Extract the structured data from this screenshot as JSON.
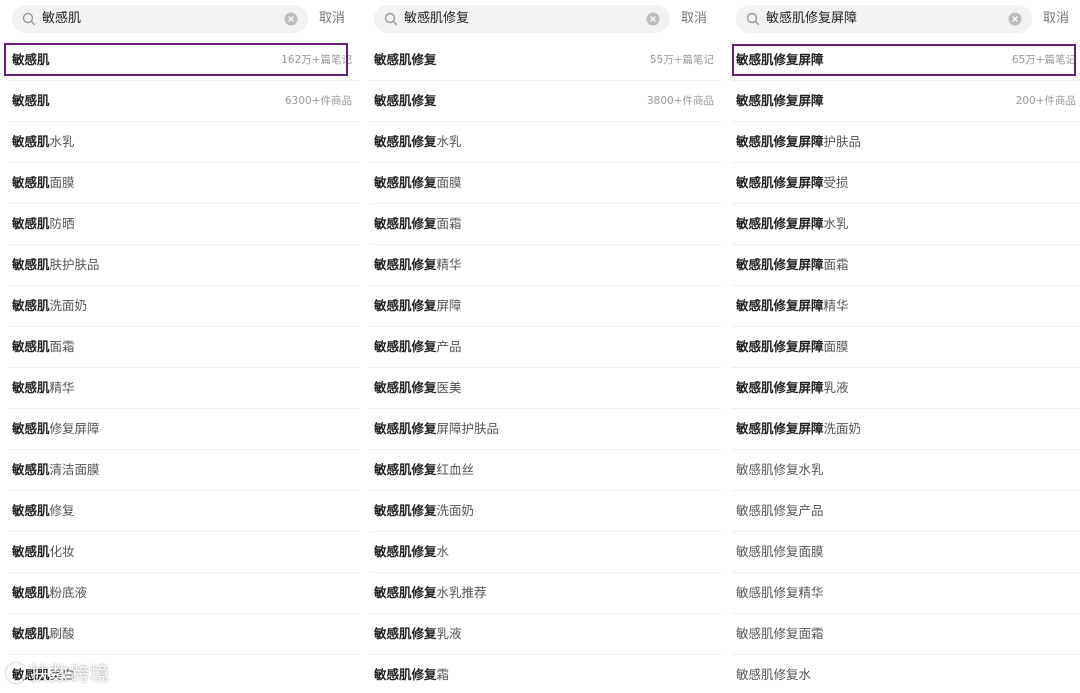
{
  "panels": [
    {
      "search": {
        "query": "敏感肌",
        "cancel": "取消"
      },
      "rows": [
        {
          "pre": "敏感肌",
          "suf": "",
          "meta": "162万+篇笔记"
        },
        {
          "pre": "敏感肌",
          "suf": "",
          "meta": "6300+件商品"
        },
        {
          "pre": "敏感肌",
          "suf": "水乳",
          "meta": ""
        },
        {
          "pre": "敏感肌",
          "suf": "面膜",
          "meta": ""
        },
        {
          "pre": "敏感肌",
          "suf": "防晒",
          "meta": ""
        },
        {
          "pre": "敏感肌",
          "suf": "肤护肤品",
          "meta": ""
        },
        {
          "pre": "敏感肌",
          "suf": "洗面奶",
          "meta": ""
        },
        {
          "pre": "敏感肌",
          "suf": "面霜",
          "meta": ""
        },
        {
          "pre": "敏感肌",
          "suf": "精华",
          "meta": ""
        },
        {
          "pre": "敏感肌",
          "suf": "修复屏障",
          "meta": ""
        },
        {
          "pre": "敏感肌",
          "suf": "清洁面膜",
          "meta": ""
        },
        {
          "pre": "敏感肌",
          "suf": "修复",
          "meta": ""
        },
        {
          "pre": "敏感肌",
          "suf": "化妆",
          "meta": ""
        },
        {
          "pre": "敏感肌",
          "suf": "粉底液",
          "meta": ""
        },
        {
          "pre": "敏感肌",
          "suf": "刷酸",
          "meta": ""
        },
        {
          "pre": "敏感肌",
          "suf": "美白",
          "meta": ""
        }
      ]
    },
    {
      "search": {
        "query": "敏感肌修复",
        "cancel": "取消"
      },
      "rows": [
        {
          "pre": "敏感肌修复",
          "suf": "",
          "meta": "55万+篇笔记"
        },
        {
          "pre": "敏感肌修复",
          "suf": "",
          "meta": "3800+件商品"
        },
        {
          "pre": "敏感肌修复",
          "suf": "水乳",
          "meta": ""
        },
        {
          "pre": "敏感肌修复",
          "suf": "面膜",
          "meta": ""
        },
        {
          "pre": "敏感肌修复",
          "suf": "面霜",
          "meta": ""
        },
        {
          "pre": "敏感肌修复",
          "suf": "精华",
          "meta": ""
        },
        {
          "pre": "敏感肌修复",
          "suf": "屏障",
          "meta": ""
        },
        {
          "pre": "敏感肌修复",
          "suf": "产品",
          "meta": ""
        },
        {
          "pre": "敏感肌修复",
          "suf": "医美",
          "meta": ""
        },
        {
          "pre": "敏感肌修复",
          "suf": "屏障护肤品",
          "meta": ""
        },
        {
          "pre": "敏感肌修复",
          "suf": "红血丝",
          "meta": ""
        },
        {
          "pre": "敏感肌修复",
          "suf": "洗面奶",
          "meta": ""
        },
        {
          "pre": "敏感肌修复",
          "suf": "水",
          "meta": ""
        },
        {
          "pre": "敏感肌修复",
          "suf": "水乳推荐",
          "meta": ""
        },
        {
          "pre": "敏感肌修复",
          "suf": "乳液",
          "meta": ""
        },
        {
          "pre": "敏感肌修复",
          "suf": "霜",
          "meta": ""
        }
      ]
    },
    {
      "search": {
        "query": "敏感肌修复屏障",
        "cancel": "取消"
      },
      "rows": [
        {
          "pre": "敏感肌修复屏障",
          "suf": "",
          "meta": "65万+篇笔记"
        },
        {
          "pre": "敏感肌修复屏障",
          "suf": "",
          "meta": "200+件商品"
        },
        {
          "pre": "敏感肌修复屏障",
          "suf": "护肤品",
          "meta": ""
        },
        {
          "pre": "敏感肌修复屏障",
          "suf": "受损",
          "meta": ""
        },
        {
          "pre": "敏感肌修复屏障",
          "suf": "水乳",
          "meta": ""
        },
        {
          "pre": "敏感肌修复屏障",
          "suf": "面霜",
          "meta": ""
        },
        {
          "pre": "敏感肌修复屏障",
          "suf": "精华",
          "meta": ""
        },
        {
          "pre": "敏感肌修复屏障",
          "suf": "面膜",
          "meta": ""
        },
        {
          "pre": "敏感肌修复屏障",
          "suf": "乳液",
          "meta": ""
        },
        {
          "pre": "敏感肌修复屏障",
          "suf": "洗面奶",
          "meta": ""
        },
        {
          "pre": "",
          "suf": "敏感肌修复水乳",
          "meta": ""
        },
        {
          "pre": "",
          "suf": "敏感肌修复产品",
          "meta": ""
        },
        {
          "pre": "",
          "suf": "敏感肌修复面膜",
          "meta": ""
        },
        {
          "pre": "",
          "suf": "敏感肌修复精华",
          "meta": ""
        },
        {
          "pre": "",
          "suf": "敏感肌修复面霜",
          "meta": ""
        },
        {
          "pre": "",
          "suf": "敏感肌修复水",
          "meta": ""
        }
      ]
    }
  ],
  "icons": {
    "search": "search-icon",
    "clear": "clear-circle-icon"
  },
  "highlight_color": "#6a1b7a",
  "watermark": "扶数跨境"
}
